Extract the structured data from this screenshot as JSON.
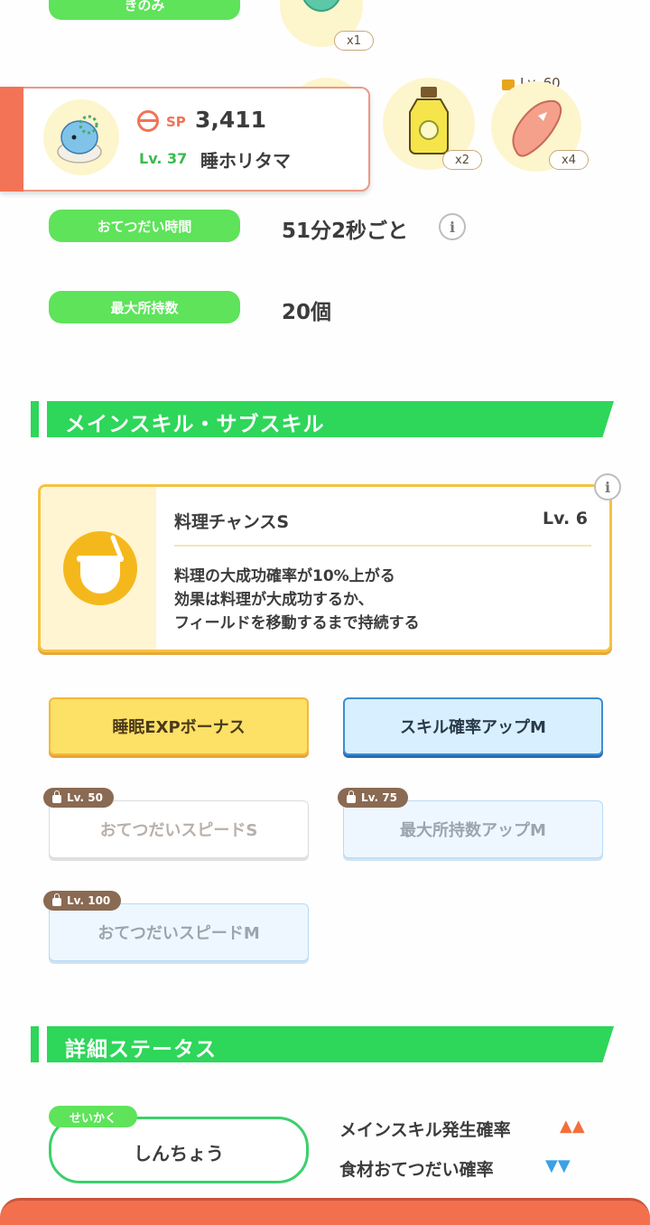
{
  "rows": {
    "berry_label": "きのみ",
    "help_time_label": "おてつだい時間",
    "help_time_value": "51分2秒ごと",
    "max_carry_label": "最大所持数",
    "max_carry_value": "20個"
  },
  "ingredients": {
    "berry_count": "x1",
    "slot2_count": "x2",
    "slot3_count": "x4",
    "slot3_lock": "Lv. 60"
  },
  "pokemon": {
    "sp_label": "SP",
    "sp_value": "3,411",
    "level_label": "Lv. 37",
    "name": "睡ホリタマ"
  },
  "sections": {
    "skills_title": "メインスキル・サブスキル",
    "detail_title": "詳細ステータス"
  },
  "main_skill": {
    "name": "料理チャンスS",
    "level": "Lv. 6",
    "desc_line1": "料理の大成功確率が10%上がる",
    "desc_line2": "効果は料理が大成功するか、",
    "desc_line3": "フィールドを移動するまで持続する"
  },
  "sub_skills": [
    {
      "label": "睡眠EXPボーナス"
    },
    {
      "label": "スキル確率アップM"
    },
    {
      "label": "おてつだいスピードS",
      "lock": "Lv. 50"
    },
    {
      "label": "最大所持数アップM",
      "lock": "Lv. 75"
    },
    {
      "label": "おてつだいスピードM",
      "lock": "Lv. 100"
    }
  ],
  "nature": {
    "tag": "せいかく",
    "value": "しんちょう",
    "up_label": "メインスキル発生確率",
    "up_marks": "▲▲",
    "down_label": "食材おてつだい確率",
    "down_marks": "▼▼"
  },
  "colors": {
    "accent_green": "#2ed65a",
    "pill_green": "#5ee35a",
    "up_orange": "#f2703a",
    "down_blue": "#3aa0e8",
    "bottom_bar": "#f2704e"
  }
}
